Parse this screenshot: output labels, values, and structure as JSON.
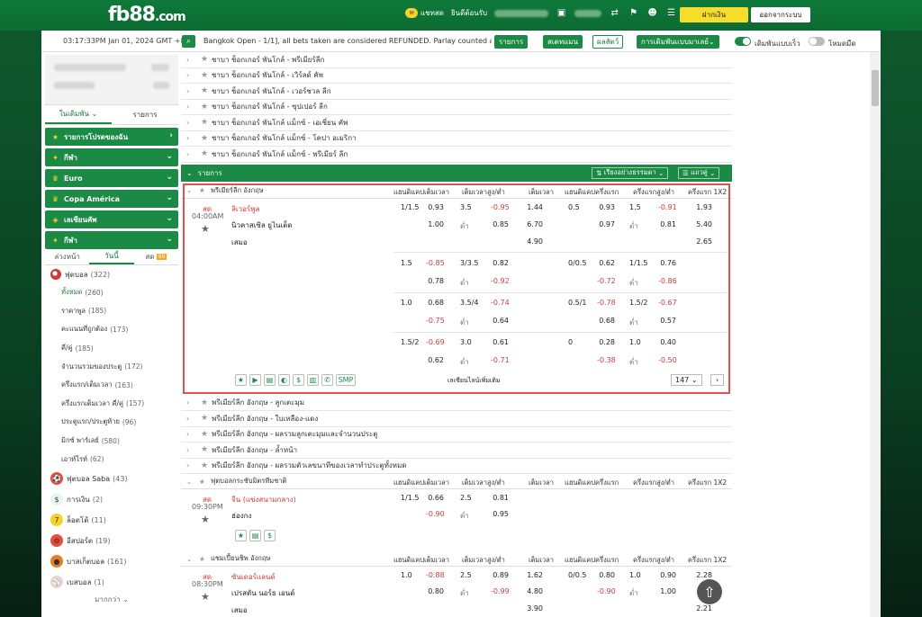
{
  "brand": {
    "logo_main": "fb88",
    "logo_suffix": ".com"
  },
  "top": {
    "chat": "แชทสด",
    "welcome": "ยินดีต้อนรับ",
    "deposit": "ฝากเงิน",
    "logout": "ออกจากระบบ"
  },
  "ticker": {
    "clock": "03:17:33PM Jan 01, 2024 GMT +8",
    "news": "Bangkok Open - 1/1], all bets taken are considered REFUNDED. Parlay counted as",
    "btn_results": "รายการ",
    "btn_stats": "สเตทแมน",
    "btn_live": "ผลสัตว์",
    "btn_mode": "การเดิมพันแบบมาเลย์",
    "toggle1": "เดิมพันแบบเร็ว",
    "toggle2": "โหมดมืด"
  },
  "side": {
    "tab_bets": "ในเดิมพัน",
    "tab_list": "รายการ",
    "groups": [
      "รายการโปรดของฉัน",
      "กีฬา",
      "Euro",
      "Copa América",
      "เลเซียนคัพ",
      "กีฬา"
    ],
    "day_tabs": [
      "ล่วงหน้า",
      "วันนี้",
      "สด"
    ],
    "day_badge": "99",
    "soccer": "ฟุตบอล",
    "soccer_cnt": "(322)",
    "subs": [
      {
        "l": "ทั้งหมด",
        "c": "(260)"
      },
      {
        "l": "ราคาพูล",
        "c": "(185)"
      },
      {
        "l": "คะแนนที่ถูกต้อง",
        "c": "(173)"
      },
      {
        "l": "คี่/คู่",
        "c": "(185)"
      },
      {
        "l": "จำนวนรวมของประตู",
        "c": "(172)"
      },
      {
        "l": "ครึ่งแรก/เต็มเวลา",
        "c": "(163)"
      },
      {
        "l": "ครึ่งแรกเต็มเวลา คี่/คู่",
        "c": "(157)"
      },
      {
        "l": "ประตูแรก/ประตูท้าย",
        "c": "(96)"
      },
      {
        "l": "มิกซ์ พาร์เลย์",
        "c": "(580)"
      },
      {
        "l": "เอาท์ไรท์",
        "c": "(62)"
      }
    ],
    "others": [
      {
        "l": "ฟุตบอล Saba",
        "c": "(43)"
      },
      {
        "l": "การเงิน",
        "c": "(2)"
      },
      {
        "l": "ล็อตโต้",
        "c": "(11)"
      },
      {
        "l": "อีสปอร์ต",
        "c": "(19)"
      },
      {
        "l": "บาสเก็ตบอล",
        "c": "(161)"
      },
      {
        "l": "เบสบอล",
        "c": "(1)"
      }
    ],
    "more": "มากกว่า"
  },
  "leagues_top": [
    "ชาบา ช็อกเกอร์ พันโกล์ - พรีเมียร์ลีก",
    "ชาบา ช็อกเกอร์ พันโกล์ - เวิร์ลด์ คัพ",
    "ชาบา ช็อกเกอร์ พันโกล์ - เวอร์ชวล ลีก",
    "ชาบา ช็อกเกอร์ พันโกล์ - ซุปเปอร์ ลีก",
    "ชาบา ช็อกเกอร์ พันโกล์ แม็กซ์ - เอเชี่ยน คัพ",
    "ชาบา ช็อกเกอร์ พันโกล์ แม็กซ์ - โคปา อเมริกา",
    "ชาบา ช็อกเกอร์ พันโกล์ แม็กซ์ - พรีเมียร์ ลีก"
  ],
  "listbar": {
    "label": "รายการ",
    "sort": "เรียงอย่างธรรมดา",
    "view": "แถวคู่"
  },
  "headers": [
    "แฮนดิแคปเต็มเวลา",
    "เต็มเวลาสูง/ต่ำ",
    "เต็มเวลา",
    "แฮนดิแคปครึ่งแรก",
    "ครึ่งแรกสูง/ต่ำ",
    "ครึ่งแรก 1X2"
  ],
  "league1": "พรีเมียร์ลีก อังกฤษ",
  "m1": {
    "live": "สด",
    "time": "04:00AM",
    "home": "ลิเวอร์พูล",
    "away": "นิวคาสเซิล ยูไนเต็ด",
    "draw": "เสมอ",
    "rows": [
      [
        "1/1.5",
        "0.93",
        "3.5",
        "-0.95",
        "1.44",
        "0.5",
        "0.93",
        "1.5",
        "-0.91",
        "1.93"
      ],
      [
        "",
        "1.00",
        "ต่ำ",
        "0.85",
        "6.70",
        "",
        "0.97",
        "ต่ำ",
        "0.81",
        "5.40"
      ],
      [
        "",
        "",
        "",
        "",
        "4.90",
        "",
        "",
        "",
        "",
        "2.65"
      ],
      [
        "1.5",
        "-0.85",
        "3/3.5",
        "0.82",
        "",
        "0/0.5",
        "0.62",
        "1/1.5",
        "0.76",
        ""
      ],
      [
        "",
        "0.78",
        "ต่ำ",
        "-0.92",
        "",
        "",
        "-0.72",
        "ต่ำ",
        "-0.86",
        ""
      ],
      [
        "1.0",
        "0.68",
        "3.5/4",
        "-0.74",
        "",
        "0.5/1",
        "-0.78",
        "1.5/2",
        "-0.67",
        ""
      ],
      [
        "",
        "-0.75",
        "ต่ำ",
        "0.64",
        "",
        "",
        "0.68",
        "ต่ำ",
        "0.57",
        ""
      ],
      [
        "1.5/2",
        "-0.69",
        "3.0",
        "0.61",
        "",
        "0",
        "0.28",
        "1.0",
        "0.40",
        ""
      ],
      [
        "",
        "0.62",
        "ต่ำ",
        "-0.71",
        "",
        "",
        "-0.38",
        "ต่ำ",
        "-0.50",
        ""
      ]
    ],
    "more_markets": "เลเซียนไลน์เพิ่มเติม",
    "count": "147",
    "smp": "SMP"
  },
  "leagues_mid": [
    "พรีเมียร์ลีก อังกฤษ - ลูกเตะมุม",
    "พรีเมียร์ลีก อังกฤษ - ใบเหลือง-แดง",
    "พรีเมียร์ลีก อังกฤษ - ผลรวมลูกเตะมุมและจำนวนประตู",
    "พรีเมียร์ลีก อังกฤษ - ล้ำหน้า",
    "พรีเมียร์ลีก อังกฤษ - ผลรวมตัวเลขนาทีของเวลาทำประตูทั้งหมด"
  ],
  "league2": "ฟุตบอลกระชับมิตรทีมชาติ",
  "m2": {
    "live": "สด",
    "time": "09:30PM",
    "home": "จีน (แข่งสนามกลาง)",
    "away": "ฮ่องกง",
    "r1": [
      "1/1.5",
      "0.66",
      "2.5",
      "0.81"
    ],
    "r2": [
      "",
      "-0.90",
      "ต่ำ",
      "0.95"
    ]
  },
  "league3": "แชมเปี้ยนชิพ อังกฤษ",
  "m3": {
    "live": "สด",
    "time": "08:30PM",
    "home": "ซันเดอร์แลนด์",
    "away": "เปรสตัน นอร์ธ เอนด์",
    "draw": "เสมอ",
    "r1": [
      "1.0",
      "-0.88",
      "2.5",
      "0.89",
      "1.62",
      "0/0.5",
      "0.80",
      "1.0",
      "0.90",
      "2.28"
    ],
    "r2": [
      "",
      "0.80",
      "ต่ำ",
      "-0.99",
      "4.80",
      "",
      "-0.90",
      "ต่ำ",
      "1.00",
      ""
    ],
    "r3": [
      "",
      "",
      "",
      "",
      "3.90",
      "",
      "",
      "",
      "",
      "2.21"
    ]
  }
}
